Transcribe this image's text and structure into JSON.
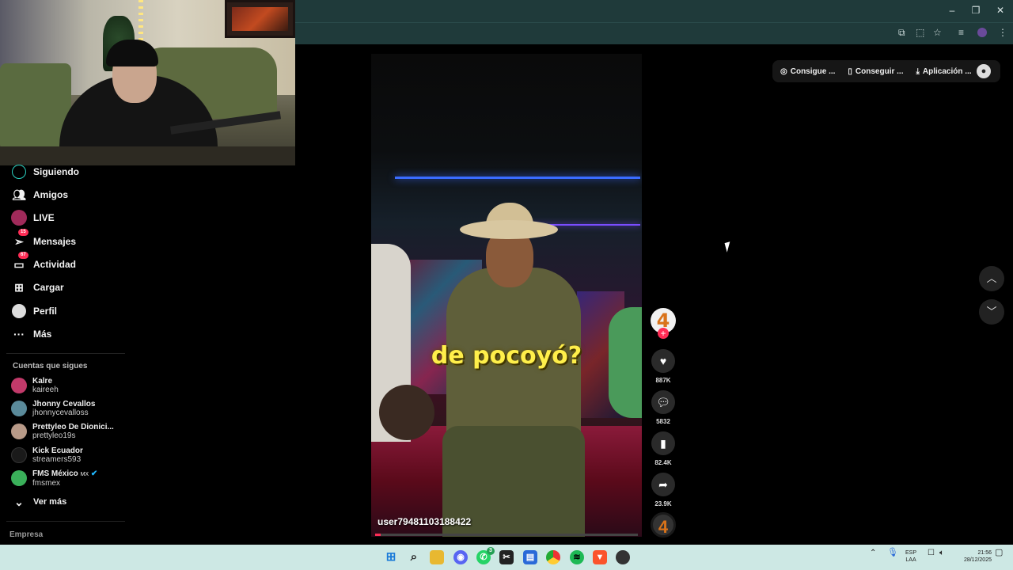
{
  "sidebar": {
    "items": [
      {
        "label": "Siguiendo",
        "icon": "following-icon"
      },
      {
        "label": "Amigos",
        "icon": "friends-icon"
      },
      {
        "label": "LIVE",
        "icon": "live-icon"
      },
      {
        "label": "Mensajes",
        "icon": "messages-icon",
        "badge": "15"
      },
      {
        "label": "Actividad",
        "icon": "activity-icon",
        "badge": "67"
      },
      {
        "label": "Cargar",
        "icon": "upload-icon"
      },
      {
        "label": "Perfil",
        "icon": "profile-icon"
      },
      {
        "label": "Más",
        "icon": "more-icon"
      }
    ],
    "following_title": "Cuentas que sigues",
    "accounts": [
      {
        "name": "Kalre",
        "handle": "kaireeh",
        "color": "#c23a6a"
      },
      {
        "name": "Jhonny Cevallos",
        "handle": "jhonnycevalloss",
        "color": "#5a8a9a"
      },
      {
        "name": "Prettyleo De Dionici...",
        "handle": "prettyleo19s",
        "color": "#b89a88"
      },
      {
        "name": "Kick Ecuador",
        "handle": "streamers593",
        "color": "#1a1a1a"
      },
      {
        "name": "FMS México",
        "suffix": "MX",
        "handle": "fmsmex",
        "color": "#3ab05a"
      }
    ],
    "see_more": "Ver más",
    "footer": "Empresa"
  },
  "top_bar": {
    "btn_coins": "Consigue ...",
    "btn_app": "Conseguir ...",
    "btn_download": "Aplicación ..."
  },
  "video": {
    "caption": "de pocoyó?",
    "username": "user79481103188422",
    "progress": 0.02
  },
  "actions": {
    "likes": "887K",
    "comments": "5832",
    "saves": "82.4K",
    "shares": "23.9K",
    "creator_initial": "4"
  },
  "taskbar": {
    "lang_top": "ESP",
    "lang_bottom": "LAA",
    "time": "21:56",
    "date": "28/12/2025",
    "whatsapp_badge": "3"
  },
  "colors": {
    "accent": "#fe2c55",
    "browser_frame": "#1f3a3a",
    "taskbar": "#cde8e4",
    "caption": "#ffef4a"
  }
}
